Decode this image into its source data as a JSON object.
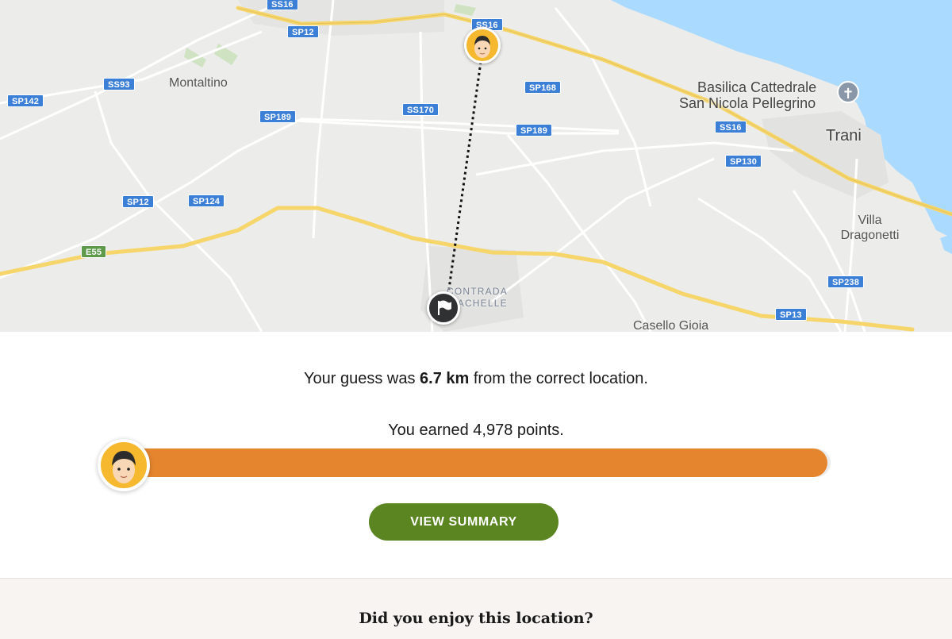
{
  "map": {
    "roads": [
      {
        "label": "SS16",
        "kind": "blue"
      },
      {
        "label": "SP12",
        "kind": "blue"
      },
      {
        "label": "SS16",
        "kind": "blue"
      },
      {
        "label": "SS93",
        "kind": "blue"
      },
      {
        "label": "SP168",
        "kind": "blue"
      },
      {
        "label": "SP142",
        "kind": "blue"
      },
      {
        "label": "SS170",
        "kind": "blue"
      },
      {
        "label": "SP189",
        "kind": "blue"
      },
      {
        "label": "SP189",
        "kind": "blue"
      },
      {
        "label": "SS16",
        "kind": "blue"
      },
      {
        "label": "SP130",
        "kind": "blue"
      },
      {
        "label": "SP12",
        "kind": "blue"
      },
      {
        "label": "SP124",
        "kind": "blue"
      },
      {
        "label": "E55",
        "kind": "green"
      },
      {
        "label": "SP238",
        "kind": "blue"
      },
      {
        "label": "SP13",
        "kind": "blue"
      }
    ],
    "places": {
      "montaltino": "Montaltino",
      "basilica_line1": "Basilica Cattedrale",
      "basilica_line2": "San Nicola Pellegrino",
      "trani": "Trani",
      "villa_line1": "Villa",
      "villa_line2": "Dragonetti",
      "contrada_line1": "CONTRADA",
      "contrada_line2": "PIACHELLE",
      "casello": "Casello Gioia"
    },
    "colors": {
      "land": "#ececea",
      "sea": "#aadaff",
      "highway": "#f6d66b",
      "road": "#ffffff"
    }
  },
  "result": {
    "distance_prefix": "Your guess was ",
    "distance_value": "6.7 km",
    "distance_suffix": " from the correct location.",
    "points_text": "You earned 4,978 points.",
    "score_fraction": 0.9956,
    "button_label": "VIEW SUMMARY"
  },
  "feedback": {
    "title": "Did you enjoy this location?"
  },
  "colors": {
    "accent_orange": "#e5862f",
    "button_green": "#5a8520",
    "marker_yellow": "#f5b82e"
  }
}
